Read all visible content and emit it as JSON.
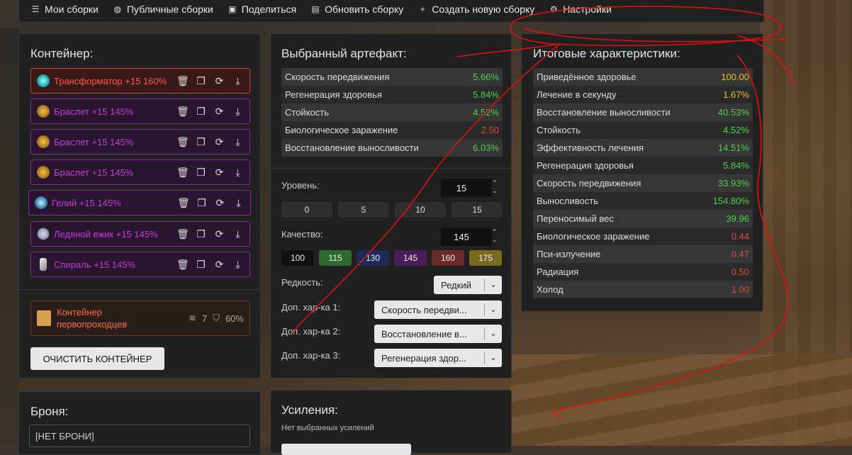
{
  "topbar": {
    "items": [
      {
        "icon": "list-icon",
        "label": "Мои сборки"
      },
      {
        "icon": "globe-icon",
        "label": "Публичные сборки"
      },
      {
        "icon": "image-icon",
        "label": "Поделиться"
      },
      {
        "icon": "save-icon",
        "label": "Обновить сборку"
      },
      {
        "icon": "plus-icon",
        "label": "Создать новую сборку"
      },
      {
        "icon": "gear-icon",
        "label": "Настройки"
      }
    ]
  },
  "container": {
    "title": "Контейнер:",
    "artifacts": [
      {
        "label": "Трансформатор +15 160%",
        "rarity": "red",
        "color": "#ff5a4a"
      },
      {
        "label": "Браслет +15 145%",
        "rarity": "purple",
        "color": "#c040d0"
      },
      {
        "label": "Браслет +15 145%",
        "rarity": "purple",
        "color": "#c040d0"
      },
      {
        "label": "Браслет +15 145%",
        "rarity": "purple",
        "color": "#c040d0"
      },
      {
        "label": "Гелий +15 145%",
        "rarity": "purple",
        "color": "#c040d0"
      },
      {
        "label": "Ледяной ежик +15 145%",
        "rarity": "purple",
        "color": "#c040d0"
      },
      {
        "label": "Спираль +15 145%",
        "rarity": "purple",
        "color": "#c040d0"
      }
    ],
    "container_name": "Контейнер первопроходцев",
    "slots": "7",
    "protection": "60%",
    "clear_label": "ОЧИСТИТЬ КОНТЕЙНЕР"
  },
  "armor": {
    "title": "Броня:",
    "value": "[НЕТ БРОНИ]"
  },
  "selected": {
    "title": "Выбранный артефакт:",
    "stats": [
      {
        "name": "Скорость передвижения",
        "value": "5.66%",
        "color": "g"
      },
      {
        "name": "Регенерация здоровья",
        "value": "5.84%",
        "color": "g"
      },
      {
        "name": "Стойкость",
        "value": "4.52%",
        "color": "g"
      },
      {
        "name": "Биологическое заражение",
        "value": "2.50",
        "color": "r"
      },
      {
        "name": "Восстановление выносливости",
        "value": "6.03%",
        "color": "g"
      }
    ],
    "level_label": "Уровень:",
    "level_value": "15",
    "level_quick": [
      "0",
      "5",
      "10",
      "15"
    ],
    "quality_label": "Качество:",
    "quality_value": "145",
    "quality_quick": [
      {
        "v": "100",
        "bg": "#111111"
      },
      {
        "v": "115",
        "bg": "#2e6a2e"
      },
      {
        "v": "130",
        "bg": "#1e2a5a"
      },
      {
        "v": "145",
        "bg": "#4a1e5a"
      },
      {
        "v": "160",
        "bg": "#6a2a26"
      },
      {
        "v": "175",
        "bg": "#7a6a1e"
      }
    ],
    "rarity_label": "Редкость:",
    "rarity_value": "Редкий",
    "extra1_label": "Доп. хар-ка 1:",
    "extra1_value": "Скорость передви...",
    "extra2_label": "Доп. хар-ка 2:",
    "extra2_value": "Восстановление в...",
    "extra3_label": "Доп. хар-ка 3:",
    "extra3_value": "Регенерация здор..."
  },
  "boosts": {
    "title": "Усиления:",
    "empty": "Нет выбранных усилений"
  },
  "final": {
    "title": "Итоговые характеристики:",
    "stats": [
      {
        "name": "Приведённое здоровье",
        "value": "100.00",
        "color": "y"
      },
      {
        "name": "Лечение в секунду",
        "value": "1.67%",
        "color": "y"
      },
      {
        "name": "Восстановление выносливости",
        "value": "40.53%",
        "color": "g"
      },
      {
        "name": "Стойкость",
        "value": "4.52%",
        "color": "g"
      },
      {
        "name": "Эффективность лечения",
        "value": "14.51%",
        "color": "g"
      },
      {
        "name": "Регенерация здоровья",
        "value": "5.84%",
        "color": "g"
      },
      {
        "name": "Скорость передвижения",
        "value": "33.93%",
        "color": "g"
      },
      {
        "name": "Выносливость",
        "value": "154.80%",
        "color": "g"
      },
      {
        "name": "Переносимый вес",
        "value": "39.96",
        "color": "g"
      },
      {
        "name": "Биологическое заражение",
        "value": "0.44",
        "color": "r"
      },
      {
        "name": "Пси-излучение",
        "value": "0.47",
        "color": "r"
      },
      {
        "name": "Радиация",
        "value": "0.50",
        "color": "r"
      },
      {
        "name": "Холод",
        "value": "1.00",
        "color": "r"
      }
    ]
  }
}
